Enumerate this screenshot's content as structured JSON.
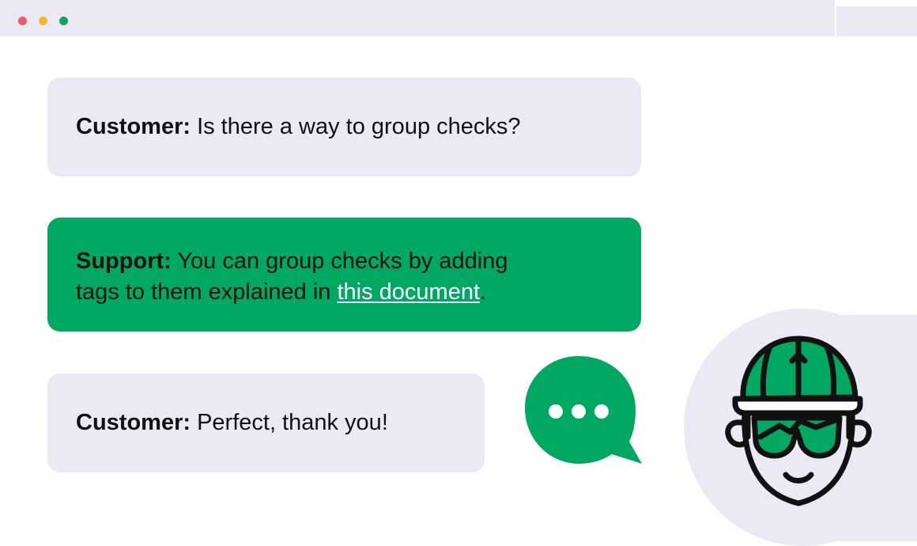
{
  "window": {
    "controls": [
      "close",
      "minimize",
      "maximize"
    ],
    "colors": {
      "close": "#f05a67",
      "minimize": "#f2b825",
      "maximize": "#13a463"
    }
  },
  "messages": [
    {
      "speaker": "Customer:",
      "text": " Is there a way to group checks?"
    },
    {
      "speaker": "Support:",
      "text_line1": " You can group checks by adding",
      "text_line2": "tags to them explained in ",
      "link": "this document",
      "after_link": "."
    },
    {
      "speaker": "Customer:",
      "text": " Perfect, thank you!"
    }
  ],
  "typing_indicator": {
    "icon": "speech-bubble-ellipsis-icon"
  },
  "avatar": {
    "icon": "mascot-face-cap-sunglasses-icon"
  },
  "colors": {
    "accent": "#00a862",
    "bubble": "#ebe9f4",
    "text": "#111111"
  }
}
